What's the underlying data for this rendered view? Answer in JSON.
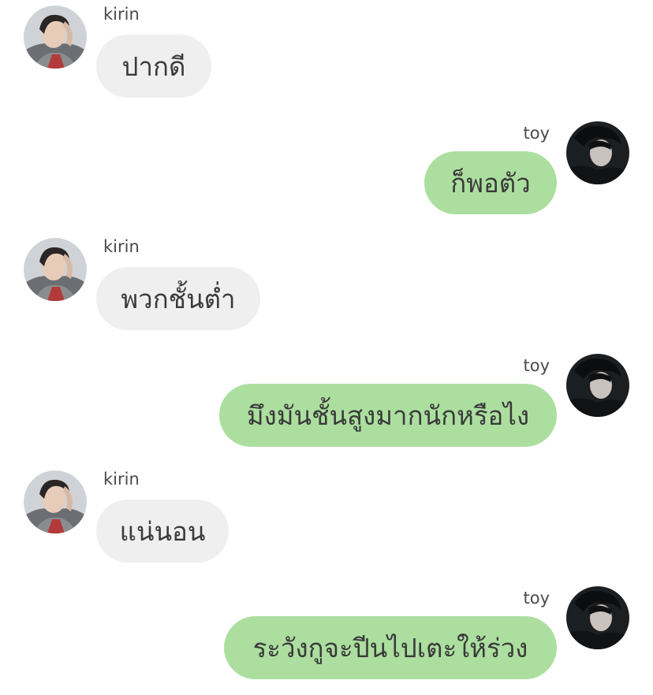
{
  "messages": [
    {
      "sender": "kirin",
      "side": "left",
      "text": "ปากดี",
      "avatar_icon": "avatar-kirin-icon"
    },
    {
      "sender": "toy",
      "side": "right",
      "text": "ก็พอตัว",
      "avatar_icon": "avatar-toy-icon"
    },
    {
      "sender": "kirin",
      "side": "left",
      "text": "พวกชั้นต่ำ",
      "avatar_icon": "avatar-kirin-icon"
    },
    {
      "sender": "toy",
      "side": "right",
      "text": "มึงมันชั้นสูงมากนักหรือไง",
      "avatar_icon": "avatar-toy-icon"
    },
    {
      "sender": "kirin",
      "side": "left",
      "text": "แน่นอน",
      "avatar_icon": "avatar-kirin-icon"
    },
    {
      "sender": "toy",
      "side": "right",
      "text": "ระวังกูจะปีนไปเตะให้ร่วง",
      "avatar_icon": "avatar-toy-icon"
    }
  ],
  "colors": {
    "left_bubble": "#efefef",
    "right_bubble": "#acdf9f",
    "text": "#3a3a3a",
    "name": "#4a4a4a",
    "background": "#ffffff"
  }
}
